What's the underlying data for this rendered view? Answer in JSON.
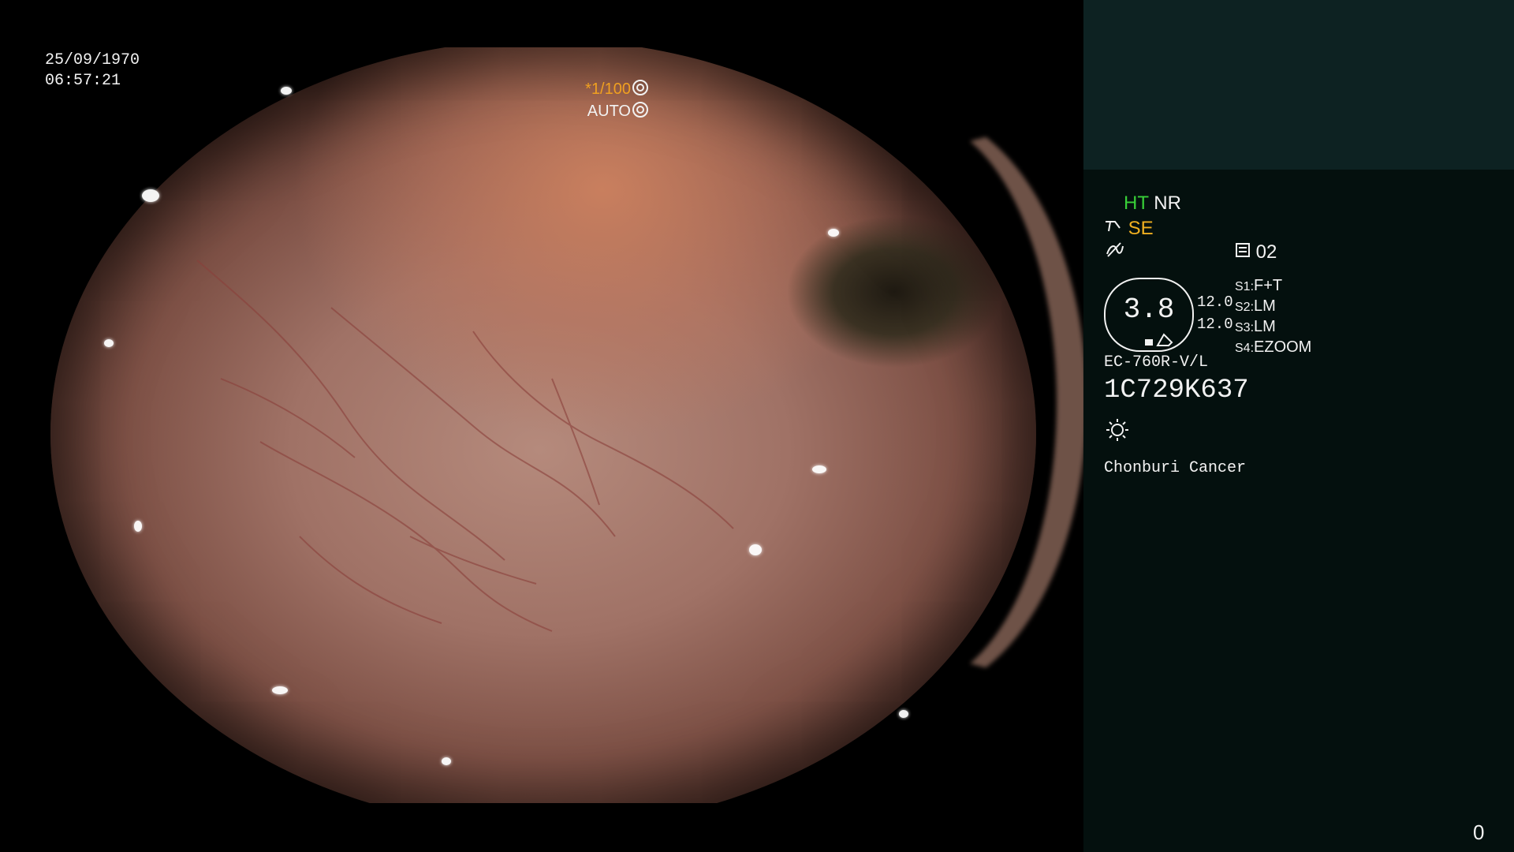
{
  "overlay": {
    "date": "25/09/1970",
    "time": "06:57:21",
    "shutter_prefix": "*",
    "shutter_value": "1/100",
    "exposure_mode": "AUTO",
    "shutter_icon": "aperture-icon",
    "auto_icon": "iris-icon"
  },
  "panel": {
    "mode_ht": "HT",
    "mode_nr": "NR",
    "se_label": "SE",
    "se_icon": "scope-tip-icon",
    "wave_icon": "wave-mark-icon",
    "channel_icon": "memory-card-icon",
    "channel_value": "02",
    "lens_value": "3.8",
    "lens_left_top": "12.0",
    "lens_left_bottom": "12.0",
    "settings": [
      {
        "key": "S1:",
        "value": "F+T"
      },
      {
        "key": "S2:",
        "value": "LM"
      },
      {
        "key": "S3:",
        "value": "LM"
      },
      {
        "key": "S4:",
        "value": "EZOOM"
      }
    ],
    "scope_model": "EC-760R-V/L",
    "serial": "1C729K637",
    "light_icon": "light-source-icon",
    "institution": "Chonburi Cancer",
    "frame_counter": "0"
  },
  "colors": {
    "panel_bg": "#04100e",
    "panel_top": "#0d2222",
    "ht_green": "#38d038",
    "se_yellow": "#f0b020"
  }
}
